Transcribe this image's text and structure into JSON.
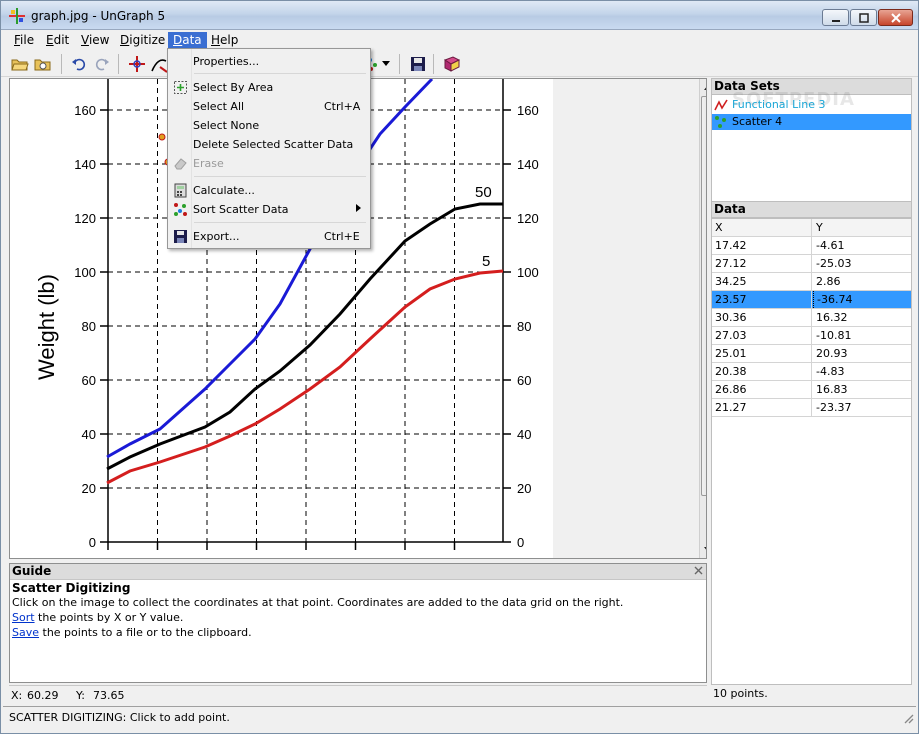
{
  "window": {
    "title": "graph.jpg - UnGraph 5"
  },
  "menu": [
    {
      "label": "File",
      "key": "F",
      "rest": "ile"
    },
    {
      "label": "Edit",
      "key": "E",
      "rest": "dit"
    },
    {
      "label": "View",
      "key": "V",
      "rest": "iew"
    },
    {
      "label": "Digitize",
      "key": "D",
      "rest": "igitize"
    },
    {
      "label": "Data",
      "key": "D",
      "rest": "ata"
    },
    {
      "label": "Help",
      "key": "H",
      "rest": "elp"
    }
  ],
  "data_menu": {
    "properties": "Properties...",
    "select_by_area": "Select By Area",
    "select_all": "Select All",
    "select_all_shortcut": "Ctrl+A",
    "select_none": "Select None",
    "delete_selected": "Delete Selected Scatter Data",
    "erase": "Erase",
    "calculate": "Calculate...",
    "sort_scatter": "Sort Scatter Data",
    "export": "Export...",
    "export_shortcut": "Ctrl+E"
  },
  "graph": {
    "ylabel": "Weight (lb)",
    "y_ticks": [
      "0",
      "20",
      "40",
      "60",
      "80",
      "100",
      "120",
      "140",
      "160"
    ],
    "curve_labels": [
      "50",
      "5"
    ],
    "colors": {
      "blue": "#1a1ad6",
      "black": "#000000",
      "red": "#d41e1e"
    }
  },
  "data_sets": {
    "header": "Data Sets",
    "items": [
      {
        "name": "Functional Line 3",
        "selected": false
      },
      {
        "name": "Scatter 4",
        "selected": true
      }
    ],
    "watermark": "SOFTPEDIA"
  },
  "data_grid": {
    "header": "Data",
    "columns": [
      "X",
      "Y"
    ],
    "rows": [
      [
        "17.42",
        "-4.61"
      ],
      [
        "27.12",
        "-25.03"
      ],
      [
        "34.25",
        "2.86"
      ],
      [
        "23.57",
        "-36.74"
      ],
      [
        "30.36",
        "16.32"
      ],
      [
        "27.03",
        "-10.81"
      ],
      [
        "25.01",
        "20.93"
      ],
      [
        "20.38",
        "-4.83"
      ],
      [
        "26.86",
        "16.83"
      ],
      [
        "21.27",
        "-23.37"
      ]
    ],
    "selected_row": 3,
    "status": "10 points."
  },
  "guide": {
    "header": "Guide",
    "title": "Scatter Digitizing",
    "line1": "Click on the image to collect the coordinates at that point. Coordinates are added to the data grid on the right.",
    "sort_link": "Sort",
    "line2_rest": " the points by X or Y value.",
    "save_link": "Save",
    "line3_rest": " the points to a file or to the clipboard."
  },
  "coords": {
    "x_label": "X:",
    "x_value": "60.29",
    "y_label": "Y:",
    "y_value": "73.65"
  },
  "status": "SCATTER DIGITIZING: Click to add point."
}
